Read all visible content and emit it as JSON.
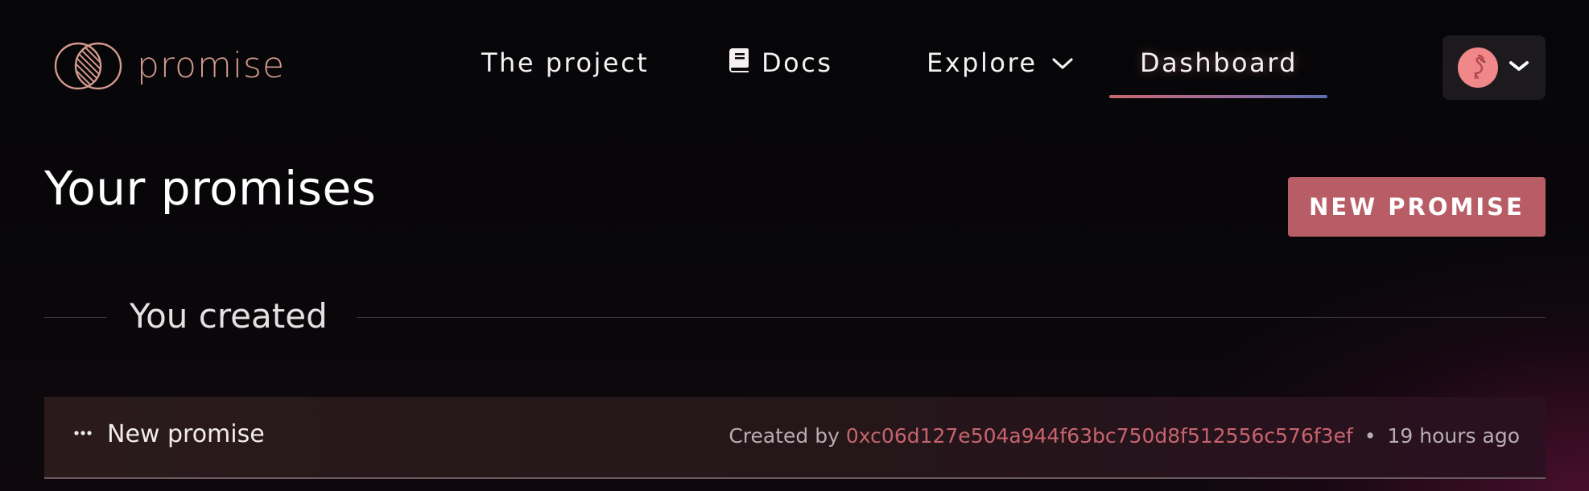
{
  "brand": {
    "name": "promise",
    "accent": "#d49a8f"
  },
  "nav": {
    "items": [
      {
        "label": "The project"
      },
      {
        "label": "Docs",
        "icon": "book-icon"
      },
      {
        "label": "Explore",
        "icon": "chevron-down-icon"
      },
      {
        "label": "Dashboard",
        "active": true
      }
    ]
  },
  "account": {
    "avatar_icon": "flamingo-icon",
    "menu_icon": "chevron-down-icon"
  },
  "main": {
    "title": "Your promises",
    "new_button_label": "NEW PROMISE",
    "section_title": "You created",
    "promises": [
      {
        "title": "New promise",
        "created_by_label": "Created by",
        "creator_address": "0xc06d127e504a944f63bc750d8f512556c576f3ef",
        "separator": "•",
        "time_ago": "19 hours ago"
      }
    ]
  },
  "colors": {
    "background": "#080608",
    "primary_button": "#b85d66",
    "address_link": "#c7646d",
    "avatar": "#f0888a"
  }
}
